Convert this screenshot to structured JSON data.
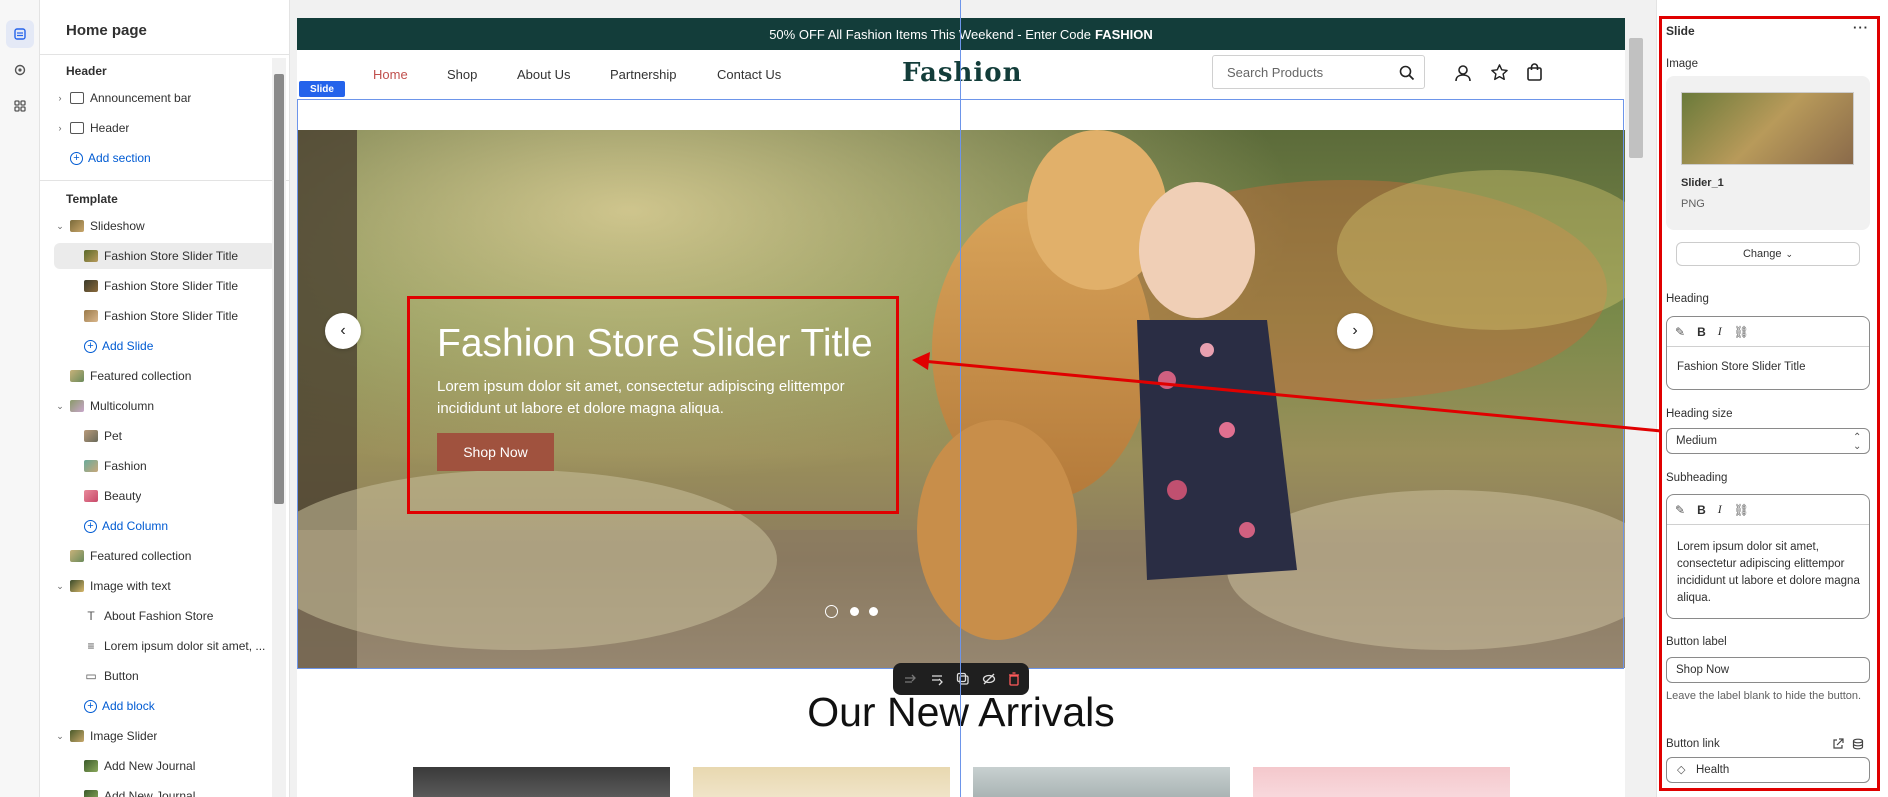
{
  "sidebar": {
    "title": "Home page",
    "header_group": "Header",
    "header_items": [
      "Announcement bar",
      "Header"
    ],
    "add_section": "Add section",
    "template_group": "Template",
    "slideshow": "Slideshow",
    "slides": [
      "Fashion Store Slider Title",
      "Fashion Store Slider Title",
      "Fashion Store Slider Title"
    ],
    "add_slide": "Add Slide",
    "featured_collection_1": "Featured collection",
    "multicolumn": "Multicolumn",
    "columns": [
      "Pet",
      "Fashion",
      "Beauty"
    ],
    "add_column": "Add Column",
    "featured_collection_2": "Featured collection",
    "image_with_text": "Image with text",
    "iwt_blocks": [
      "About Fashion Store",
      "Lorem ipsum dolor sit amet, ...",
      "Button"
    ],
    "add_block": "Add block",
    "image_slider": "Image Slider",
    "journals": [
      "Add New Journal",
      "Add New Journal"
    ]
  },
  "store": {
    "announcement": "50% OFF All Fashion Items This Weekend - Enter Code",
    "announcement_code": "FASHION",
    "nav": [
      "Home",
      "Shop",
      "About Us",
      "Partnership",
      "Contact Us"
    ],
    "logo": "Fashion",
    "search_placeholder": "Search Products",
    "slide_tag": "Slide",
    "hero_title": "Fashion Store Slider Title",
    "hero_subtitle": "Lorem ipsum dolor sit amet, consectetur adipiscing elittempor incididunt ut labore et dolore magna aliqua.",
    "hero_button": "Shop Now",
    "section_heading": "Our New Arrivals",
    "active_nav_color": "#c0504d",
    "topbar_color": "#133d3a"
  },
  "panel": {
    "title": "Slide",
    "image_label": "Image",
    "image_name": "Slider_1",
    "image_type": "PNG",
    "change_button": "Change",
    "heading_label": "Heading",
    "heading_value": "Fashion Store Slider Title",
    "heading_size_label": "Heading size",
    "heading_size_value": "Medium",
    "subheading_label": "Subheading",
    "subheading_value": "Lorem ipsum dolor sit amet, consectetur adipiscing elittempor incididunt ut labore et dolore magna aliqua.",
    "button_label_label": "Button label",
    "button_label_value": "Shop Now",
    "button_label_help": "Leave the label blank to hide the button.",
    "button_link_label": "Button link",
    "button_link_value": "Health",
    "rte_bold": "B",
    "rte_italic": "I"
  },
  "highlight_color": "#e00000"
}
